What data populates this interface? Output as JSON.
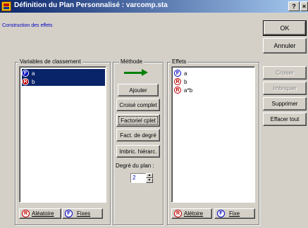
{
  "window": {
    "title": "Définition du Plan Personnalisé : varcomp.sta",
    "help_button": "?",
    "close_button": "×"
  },
  "subtitle": "Construction des effets",
  "right_buttons": {
    "ok": "OK",
    "cancel": "Annuler",
    "cross": "Croiser",
    "nest": "Imbriquer",
    "delete": "Supprimer",
    "clear_all": "Effacer tout"
  },
  "classification": {
    "label": "Variables de classement",
    "items": [
      {
        "badge": "F",
        "kind": "f",
        "name": "a"
      },
      {
        "badge": "R",
        "kind": "r",
        "name": "b"
      }
    ],
    "random_button": "Aléatoire",
    "fixed_button": "Fixes"
  },
  "method": {
    "label": "Méthode",
    "add": "Ajouter",
    "crossed_complete": "Croisé complet",
    "factorial_complete": "Factoriel cplet",
    "factorial_degree": "Fact. de degré",
    "nested_hier": "Imbric. hiérarc.",
    "degree_label": "Degré du plan :",
    "degree_value": "2"
  },
  "effects": {
    "label": "Effets",
    "items": [
      {
        "badge": "F",
        "kind": "f",
        "name": "a"
      },
      {
        "badge": "R",
        "kind": "r",
        "name": "b"
      },
      {
        "badge": "R",
        "kind": "r",
        "name": "a*b"
      }
    ],
    "random_button": "Alétoire",
    "fixed_button": "Fixe"
  },
  "colors": {
    "title_start": "#0a246a",
    "title_end": "#a6caf0",
    "fixed": "#0000c0",
    "random": "#c00000",
    "arrow": "#008000"
  }
}
